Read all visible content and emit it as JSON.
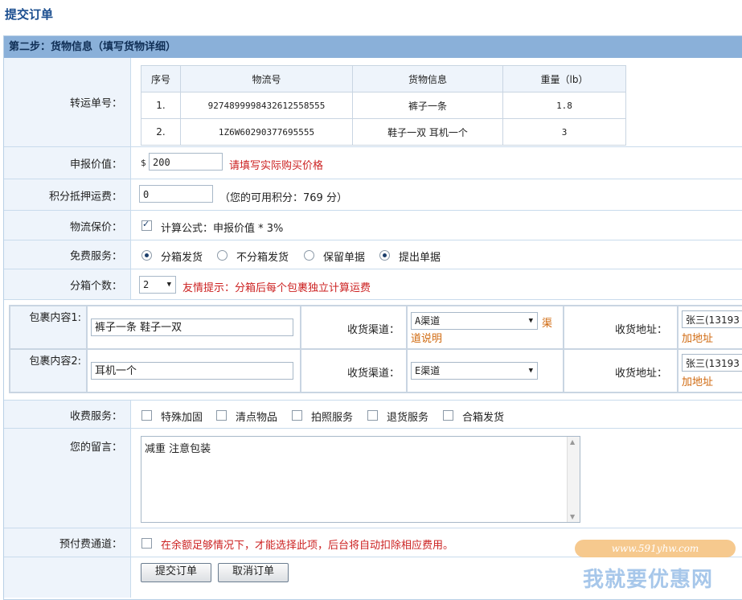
{
  "page_title": "提交订单",
  "section_title": "第二步：货物信息（填写货物详细）",
  "transfer": {
    "label": "转运单号：",
    "headers": [
      "序号",
      "物流号",
      "货物信息",
      "重量（lb）"
    ],
    "rows": [
      {
        "no": "1.",
        "tracking": "9274899998432612558555",
        "goods": "裤子一条",
        "weight": "1.8"
      },
      {
        "no": "2.",
        "tracking": "1Z6W60290377695555",
        "goods": "鞋子一双 耳机一个",
        "weight": "3"
      }
    ]
  },
  "declared": {
    "label": "申报价值：",
    "currency": "$",
    "value": "200",
    "hint": "请填写实际购买价格"
  },
  "points": {
    "label": "积分抵押运费：",
    "value": "0",
    "note": "（您的可用积分：769 分）"
  },
  "insurance": {
    "label": "物流保价：",
    "text": "计算公式：申报价值 * 3%"
  },
  "free_service": {
    "label": "免费服务：",
    "options": [
      "分箱发货",
      "不分箱发货",
      "保留单据",
      "提出单据"
    ]
  },
  "split": {
    "label": "分箱个数：",
    "value": "2",
    "hint": "友情提示：分箱后每个包裹独立计算运费"
  },
  "packages": [
    {
      "label": "包裹内容1:",
      "content": "裤子一条 鞋子一双",
      "channel_label": "收货渠道：",
      "channel": "A渠道",
      "channel_link": "渠道说明",
      "addr_label": "收货地址：",
      "addr": "张三(13193",
      "add_addr": "加地址"
    },
    {
      "label": "包裹内容2:",
      "content": "耳机一个",
      "channel_label": "收货渠道：",
      "channel": "E渠道",
      "channel_link": "",
      "addr_label": "收货地址：",
      "addr": "张三(13193",
      "add_addr": "加地址"
    }
  ],
  "paid_service": {
    "label": "收费服务：",
    "options": [
      "特殊加固",
      "清点物品",
      "拍照服务",
      "退货服务",
      "合箱发货"
    ]
  },
  "message": {
    "label": "您的留言：",
    "value": "减重 注意包装"
  },
  "prepay": {
    "label": "预付费通道：",
    "text": "在余额足够情况下，才能选择此项，后台将自动扣除相应费用。"
  },
  "buttons": {
    "submit": "提交订单",
    "cancel": "取消订单"
  },
  "watermark": {
    "url": "www.591yhw.com",
    "name": "我就要优惠网"
  }
}
